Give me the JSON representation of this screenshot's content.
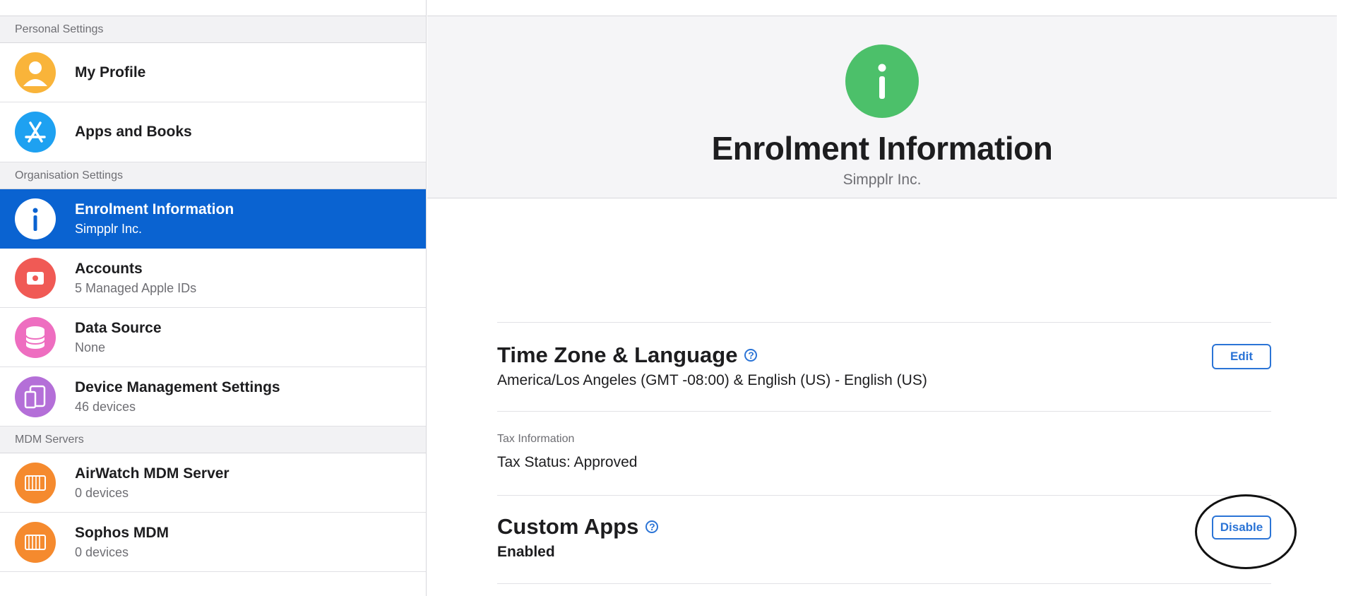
{
  "sidebar": {
    "sections": [
      {
        "header": "Personal Settings"
      },
      {
        "header": "Organisation Settings"
      },
      {
        "header": "MDM Servers"
      }
    ],
    "items": [
      {
        "title": "My Profile",
        "subtitle": "",
        "icon": "user-icon",
        "color": "#f9b43a"
      },
      {
        "title": "Apps and Books",
        "subtitle": "",
        "icon": "app-store-icon",
        "color": "#1ea1f1"
      },
      {
        "title": "Enrolment Information",
        "subtitle": "Simpplr Inc.",
        "icon": "info-icon",
        "color": "#ffffff",
        "selected": true
      },
      {
        "title": "Accounts",
        "subtitle": "5 Managed Apple IDs",
        "icon": "apple-id-icon",
        "color": "#f05a55"
      },
      {
        "title": "Data Source",
        "subtitle": "None",
        "icon": "database-icon",
        "color": "#ee6ec0"
      },
      {
        "title": "Device Management Settings",
        "subtitle": "46 devices",
        "icon": "devices-icon",
        "color": "#b46fd8"
      },
      {
        "title": "AirWatch MDM Server",
        "subtitle": "0 devices",
        "icon": "server-icon",
        "color": "#f58a2e"
      },
      {
        "title": "Sophos MDM",
        "subtitle": "0 devices",
        "icon": "server-icon",
        "color": "#f58a2e"
      }
    ]
  },
  "hero": {
    "icon": "info-icon",
    "icon_color": "#4cc06a",
    "title": "Enrolment Information",
    "subtitle": "Simpplr Inc."
  },
  "timezone": {
    "title": "Time Zone & Language",
    "value": "America/Los Angeles (GMT -08:00) & English (US) - English (US)",
    "edit_label": "Edit"
  },
  "tax": {
    "label": "Tax Information",
    "value": "Tax Status: Approved"
  },
  "custom_apps": {
    "title": "Custom Apps",
    "value": "Enabled",
    "disable_label": "Disable"
  },
  "colors": {
    "accent": "#0a63d1",
    "link": "#2b74d6"
  }
}
